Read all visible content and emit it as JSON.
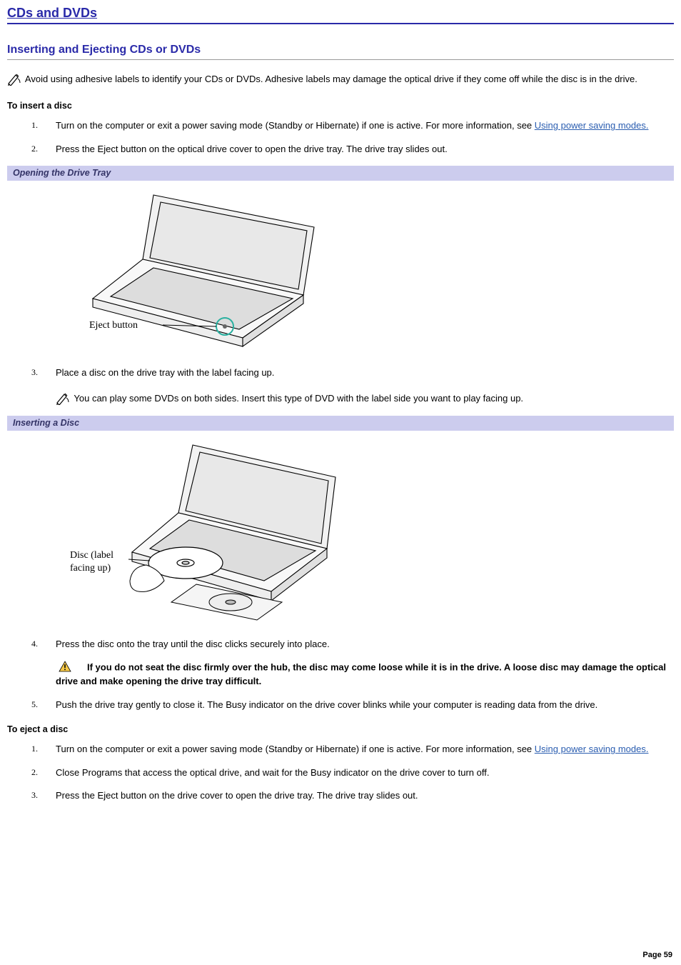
{
  "chapter_title": "CDs and DVDs",
  "section_title": "Inserting and Ejecting CDs or DVDs",
  "top_note": "Avoid using adhesive labels to identify your CDs or DVDs. Adhesive labels may damage the optical drive if they come off while the disc is in the drive.",
  "insert_heading": "To insert a disc",
  "insert_steps": {
    "s1a": "Turn on the computer or exit a power saving mode (Standby or Hibernate) if one is active. For more information, see ",
    "s1_link": "Using power saving modes.",
    "s2": "Press the Eject button on the optical drive cover to open the drive tray. The drive tray slides out.",
    "s3": "Place a disc on the drive tray with the label facing up.",
    "s3_note": "You can play some DVDs on both sides. Insert this type of DVD with the label side you want to play facing up.",
    "s4": "Press the disc onto the tray until the disc clicks securely into place.",
    "s4_warn": "If you do not seat the disc firmly over the hub, the disc may come loose while it is in the drive. A loose disc may damage the optical drive and make opening the drive tray difficult.",
    "s5": "Push the drive tray gently to close it. The Busy indicator on the drive cover blinks while your computer is reading data from the drive."
  },
  "caption1": "Opening the Drive Tray",
  "fig1_label": "Eject button",
  "caption2": "Inserting a Disc",
  "fig2_label1": "Disc (label",
  "fig2_label2": "facing up)",
  "eject_heading": "To eject a disc",
  "eject_steps": {
    "s1a": "Turn on the computer or exit a power saving mode (Standby or Hibernate) if one is active. For more information, see ",
    "s1_link": "Using power saving modes.",
    "s2": "Close Programs that access the optical drive, and wait for the Busy indicator on the drive cover to turn off.",
    "s3": "Press the Eject button on the drive cover to open the drive tray. The drive tray slides out."
  },
  "page_label": "Page 59"
}
